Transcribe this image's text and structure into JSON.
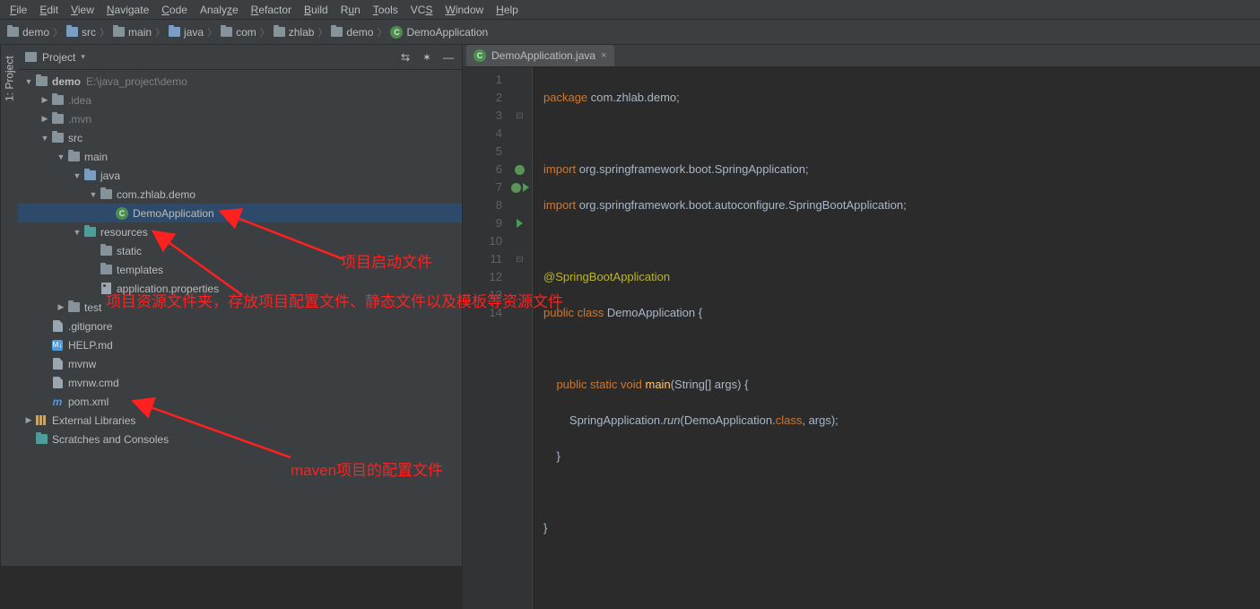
{
  "menu": [
    "File",
    "Edit",
    "View",
    "Navigate",
    "Code",
    "Analyze",
    "Refactor",
    "Build",
    "Run",
    "Tools",
    "VCS",
    "Window",
    "Help"
  ],
  "breadcrumb": [
    "demo",
    "src",
    "main",
    "java",
    "com",
    "zhlab",
    "demo",
    "DemoApplication"
  ],
  "projectPanel": {
    "title": "Project"
  },
  "leftStrip": {
    "projectTab": "1: Project"
  },
  "tree": {
    "root": {
      "name": "demo",
      "path": "E:\\java_project\\demo"
    },
    "idea": ".idea",
    "mvn": ".mvn",
    "src": "src",
    "main": "main",
    "java": "java",
    "pkg": "com.zhlab.demo",
    "demoApp": "DemoApplication",
    "resources": "resources",
    "static": "static",
    "templates": "templates",
    "appprops": "application.properties",
    "test": "test",
    "gitignore": ".gitignore",
    "help": "HELP.md",
    "mvnw": "mvnw",
    "mvnwcmd": "mvnw.cmd",
    "pom": "pom.xml",
    "extlib": "External Libraries",
    "scratches": "Scratches and Consoles"
  },
  "editorTab": "DemoApplication.java",
  "code": {
    "l1a": "package",
    "l1b": "com.zhlab.demo",
    "l3a": "import",
    "l3b": "org.springframework.boot.SpringApplication",
    "l4a": "import",
    "l4b": "org.springframework.boot.autoconfigure.",
    "l4c": "SpringBootApplication",
    "l6": "@SpringBootApplication",
    "l7a": "public",
    "l7b": "class",
    "l7c": "DemoApplication",
    "l7d": "{",
    "l9a": "public",
    "l9b": "static",
    "l9c": "void",
    "l9d": "main",
    "l9e": "(String[] args)",
    "l9f": "{",
    "l10a": "SpringApplication.",
    "l10b": "run",
    "l10c": "(DemoApplication.",
    "l10d": "class",
    "l10e": ", args);",
    "l11": "}",
    "l13": "}"
  },
  "lineNumbers": [
    "1",
    "2",
    "3",
    "4",
    "5",
    "6",
    "7",
    "8",
    "9",
    "10",
    "11",
    "12",
    "13",
    "14"
  ],
  "annotations": {
    "a1": "项目启动文件",
    "a2": "项目资源文件夹，存放项目配置文件、静态文件以及模板等资源文件",
    "a3": "maven项目的配置文件"
  }
}
